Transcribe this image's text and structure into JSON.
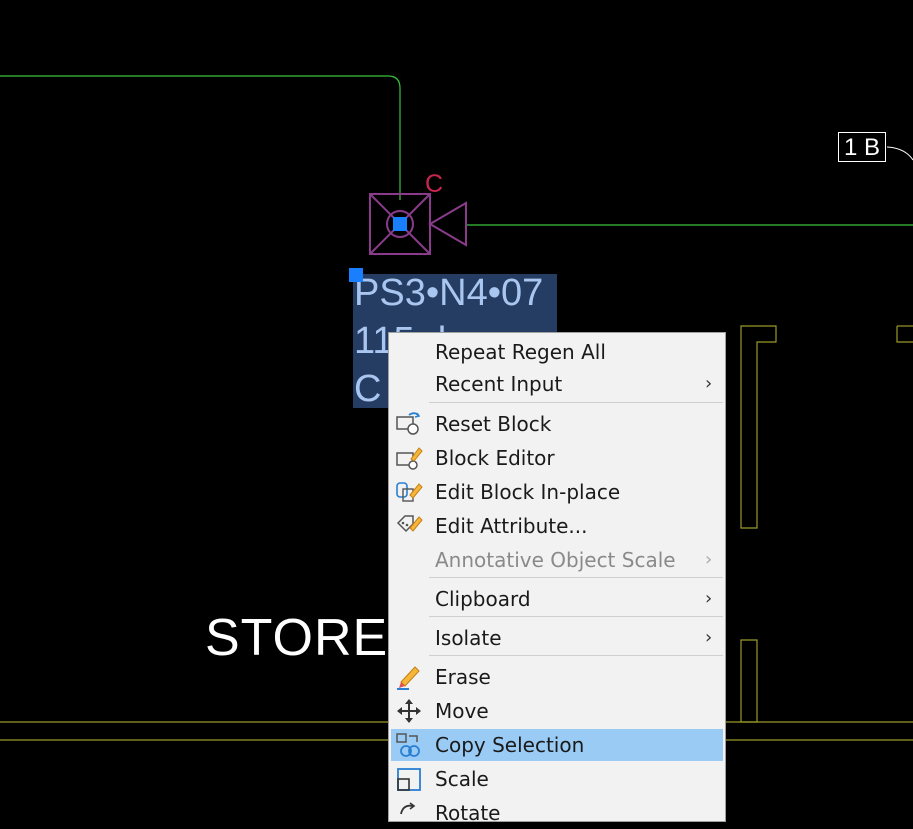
{
  "drawing": {
    "tag_label": "1 B",
    "camera_label": "C",
    "attribute_lines": [
      "PS3•N4•07",
      "115 d",
      "C"
    ],
    "room_label": "STORE",
    "colors": {
      "background": "#000000",
      "green_lines": "#39c43a",
      "olive_lines": "#9a9a26",
      "camera_outline": "#8b3b8b",
      "camera_label": "#c8264e",
      "grip": "#1a7fff",
      "selection_highlight": "#263d63"
    }
  },
  "context_menu": {
    "items": [
      {
        "label": "Repeat Regen All",
        "icon": "",
        "submenu": false,
        "enabled": true
      },
      {
        "label": "Recent Input",
        "icon": "",
        "submenu": true,
        "enabled": true
      },
      {
        "label": "Reset Block",
        "icon": "reset-block-icon",
        "submenu": false,
        "enabled": true
      },
      {
        "label": "Block Editor",
        "icon": "block-editor-icon",
        "submenu": false,
        "enabled": true
      },
      {
        "label": "Edit Block In-place",
        "icon": "edit-block-inplace-icon",
        "submenu": false,
        "enabled": true
      },
      {
        "label": "Edit Attribute...",
        "icon": "edit-attribute-icon",
        "submenu": false,
        "enabled": true
      },
      {
        "label": "Annotative Object Scale",
        "icon": "",
        "submenu": true,
        "enabled": false
      },
      {
        "label": "Clipboard",
        "icon": "",
        "submenu": true,
        "enabled": true
      },
      {
        "label": "Isolate",
        "icon": "",
        "submenu": true,
        "enabled": true
      },
      {
        "label": "Erase",
        "icon": "erase-icon",
        "submenu": false,
        "enabled": true
      },
      {
        "label": "Move",
        "icon": "move-icon",
        "submenu": false,
        "enabled": true
      },
      {
        "label": "Copy Selection",
        "icon": "copy-selection-icon",
        "submenu": false,
        "enabled": true,
        "highlighted": true
      },
      {
        "label": "Scale",
        "icon": "scale-icon",
        "submenu": false,
        "enabled": true
      },
      {
        "label": "Rotate",
        "icon": "rotate-icon",
        "submenu": false,
        "enabled": true
      }
    ],
    "chevron": "›",
    "highlight_color": "#99cbf5"
  }
}
